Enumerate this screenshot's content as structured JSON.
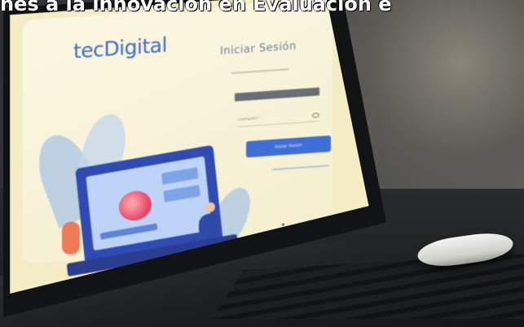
{
  "photo": {
    "overlay_headline": "nes a la innovación en Evaluación e",
    "screen": {
      "brand_logo": "tecDigital",
      "login_title": "Iniciar Sesión",
      "password_label": "Contraseña *",
      "login_button_label": "Iniciar Sesión"
    }
  }
}
